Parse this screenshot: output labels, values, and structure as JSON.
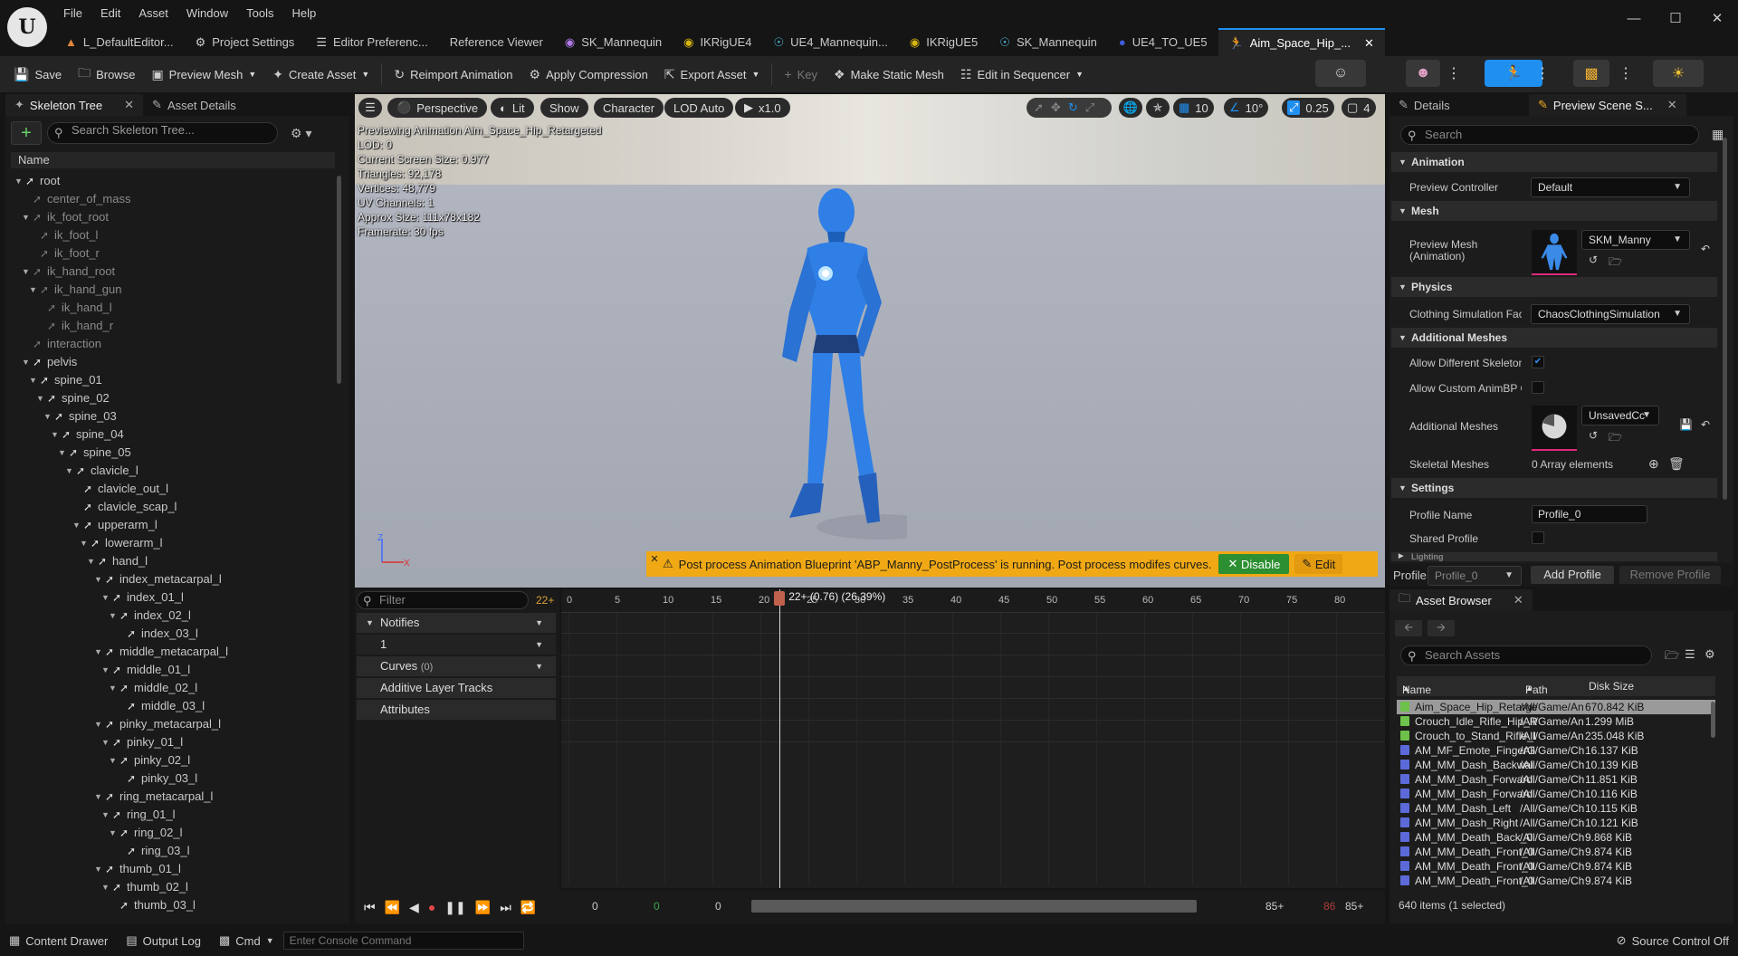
{
  "menu": [
    "File",
    "Edit",
    "Asset",
    "Window",
    "Tools",
    "Help"
  ],
  "doc_tabs": [
    {
      "label": "L_DefaultEditor...",
      "icon": "level-icon",
      "color": "#e2863b"
    },
    {
      "label": "Project Settings",
      "icon": "gear-icon",
      "color": "#cccccc"
    },
    {
      "label": "Editor Preferenc...",
      "icon": "sliders-icon",
      "color": "#cccccc"
    },
    {
      "label": "Reference Viewer",
      "icon": "",
      "color": "#cccccc"
    },
    {
      "label": "SK_Mannequin",
      "icon": "skeleton-icon",
      "color": "#b07ae8"
    },
    {
      "label": "IKRigUE4",
      "icon": "ikrig-icon",
      "color": "#d6b410"
    },
    {
      "label": "UE4_Mannequin...",
      "icon": "skeletal-mesh-icon",
      "color": "#4ec0e8"
    },
    {
      "label": "IKRigUE5",
      "icon": "ikrig-icon",
      "color": "#d6b410"
    },
    {
      "label": "SK_Mannequin",
      "icon": "skeletal-mesh-icon",
      "color": "#4ec0e8"
    },
    {
      "label": "UE4_TO_UE5",
      "icon": "retargeter-icon",
      "color": "#3f5bd8"
    },
    {
      "label": "Aim_Space_Hip_...",
      "icon": "animation-icon",
      "color": "#6cc24a",
      "active": true
    }
  ],
  "toolbar": {
    "save": "Save",
    "browse": "Browse",
    "preview_mesh": "Preview Mesh",
    "create_asset": "Create Asset",
    "reimport": "Reimport Animation",
    "apply_compression": "Apply Compression",
    "export_asset": "Export Asset",
    "key": "Key",
    "make_static_mesh": "Make Static Mesh",
    "edit_in_sequencer": "Edit in Sequencer"
  },
  "left_panel": {
    "tabs": [
      "Skeleton Tree",
      "Asset Details"
    ],
    "search_placeholder": "Search Skeleton Tree...",
    "column": "Name",
    "bones": [
      {
        "name": "root",
        "depth": 0,
        "dim": false
      },
      {
        "name": "center_of_mass",
        "depth": 1,
        "dim": true
      },
      {
        "name": "ik_foot_root",
        "depth": 1,
        "dim": true
      },
      {
        "name": "ik_foot_l",
        "depth": 2,
        "dim": true
      },
      {
        "name": "ik_foot_r",
        "depth": 2,
        "dim": true
      },
      {
        "name": "ik_hand_root",
        "depth": 1,
        "dim": true
      },
      {
        "name": "ik_hand_gun",
        "depth": 2,
        "dim": true
      },
      {
        "name": "ik_hand_l",
        "depth": 3,
        "dim": true
      },
      {
        "name": "ik_hand_r",
        "depth": 3,
        "dim": true
      },
      {
        "name": "interaction",
        "depth": 1,
        "dim": true
      },
      {
        "name": "pelvis",
        "depth": 1,
        "dim": false
      },
      {
        "name": "spine_01",
        "depth": 2,
        "dim": false
      },
      {
        "name": "spine_02",
        "depth": 3,
        "dim": false
      },
      {
        "name": "spine_03",
        "depth": 4,
        "dim": false
      },
      {
        "name": "spine_04",
        "depth": 5,
        "dim": false
      },
      {
        "name": "spine_05",
        "depth": 6,
        "dim": false
      },
      {
        "name": "clavicle_l",
        "depth": 7,
        "dim": false
      },
      {
        "name": "clavicle_out_l",
        "depth": 8,
        "dim": false
      },
      {
        "name": "clavicle_scap_l",
        "depth": 8,
        "dim": false
      },
      {
        "name": "upperarm_l",
        "depth": 8,
        "dim": false
      },
      {
        "name": "lowerarm_l",
        "depth": 9,
        "dim": false
      },
      {
        "name": "hand_l",
        "depth": 10,
        "dim": false
      },
      {
        "name": "index_metacarpal_l",
        "depth": 11,
        "dim": false
      },
      {
        "name": "index_01_l",
        "depth": 12,
        "dim": false
      },
      {
        "name": "index_02_l",
        "depth": 13,
        "dim": false
      },
      {
        "name": "index_03_l",
        "depth": 14,
        "dim": false
      },
      {
        "name": "middle_metacarpal_l",
        "depth": 11,
        "dim": false
      },
      {
        "name": "middle_01_l",
        "depth": 12,
        "dim": false
      },
      {
        "name": "middle_02_l",
        "depth": 13,
        "dim": false
      },
      {
        "name": "middle_03_l",
        "depth": 14,
        "dim": false
      },
      {
        "name": "pinky_metacarpal_l",
        "depth": 11,
        "dim": false
      },
      {
        "name": "pinky_01_l",
        "depth": 12,
        "dim": false
      },
      {
        "name": "pinky_02_l",
        "depth": 13,
        "dim": false
      },
      {
        "name": "pinky_03_l",
        "depth": 14,
        "dim": false
      },
      {
        "name": "ring_metacarpal_l",
        "depth": 11,
        "dim": false
      },
      {
        "name": "ring_01_l",
        "depth": 12,
        "dim": false
      },
      {
        "name": "ring_02_l",
        "depth": 13,
        "dim": false
      },
      {
        "name": "ring_03_l",
        "depth": 14,
        "dim": false
      },
      {
        "name": "thumb_01_l",
        "depth": 11,
        "dim": false
      },
      {
        "name": "thumb_02_l",
        "depth": 12,
        "dim": false
      },
      {
        "name": "thumb_03_l",
        "depth": 13,
        "dim": false
      }
    ]
  },
  "viewport": {
    "buttons": {
      "perspective": "Perspective",
      "lit": "Lit",
      "show": "Show",
      "character": "Character",
      "lod": "LOD Auto",
      "speed": "x1.0"
    },
    "right_controls": {
      "grid": "10",
      "rot": "10°",
      "scale": "0.25",
      "cam": "4"
    },
    "stats": [
      "Previewing Animation Aim_Space_Hip_Retargeted",
      "LOD: 0",
      "Current Screen Size: 0.977",
      "Triangles: 92,178",
      "Vertices: 48,779",
      "UV Channels: 1",
      "Approx Size: 111x78x182",
      "Framerate: 30 fps"
    ],
    "warning": "Post process Animation Blueprint 'ABP_Manny_PostProcess' is running. Post process modifes curves.",
    "warning_disable": "Disable",
    "warning_edit": "Edit",
    "axis_z": "Z",
    "axis_x": "X"
  },
  "timeline": {
    "filter_placeholder": "Filter",
    "frame_marker": "22+",
    "tracks": {
      "notifies": "Notifies",
      "notify_1": "1",
      "curves": "Curves",
      "curves_count": "(0)",
      "additive": "Additive Layer Tracks",
      "attributes": "Attributes"
    },
    "ruler": [
      "0",
      "5",
      "10",
      "15",
      "20",
      "25",
      "30",
      "35",
      "40",
      "45",
      "50",
      "55",
      "60",
      "65",
      "70",
      "75",
      "80"
    ],
    "playhead_label": "22+ (0.76) (26.39%)",
    "bottom": {
      "a": "0",
      "b": "0",
      "c": "0",
      "d": "85+",
      "e": "86",
      "f": "85+"
    }
  },
  "details": {
    "tabs": [
      "Details",
      "Preview Scene S..."
    ],
    "search_placeholder": "Search",
    "categories": {
      "animation": "Animation",
      "mesh": "Mesh",
      "physics": "Physics",
      "additional": "Additional Meshes",
      "settings": "Settings",
      "lighting": "Lighting"
    },
    "props": {
      "preview_controller": "Preview Controller",
      "preview_controller_val": "Default",
      "preview_mesh": "Preview Mesh (Animation)",
      "preview_mesh_val": "SKM_Manny",
      "clothing": "Clothing Simulation Fact",
      "clothing_val": "ChaosClothingSimulation",
      "allow_diff_skel": "Allow Different Skeleton",
      "allow_custom": "Allow Custom AnimBP C",
      "additional_meshes": "Additional Meshes",
      "additional_val": "UnsavedCc",
      "skeletal_meshes": "Skeletal Meshes",
      "skeletal_val": "0 Array elements",
      "profile_name": "Profile Name",
      "profile_name_val": "Profile_0",
      "shared_profile": "Shared Profile"
    },
    "profile_label": "Profile",
    "profile_val": "Profile_0",
    "add_profile": "Add Profile",
    "remove_profile": "Remove Profile"
  },
  "asset_browser": {
    "title": "Asset Browser",
    "search_placeholder": "Search Assets",
    "columns": {
      "name": "Name",
      "path": "Path",
      "size": "Disk Size"
    },
    "rows": [
      {
        "name": "Aim_Space_Hip_Retarge",
        "path": "/All/Game/An",
        "size": "670.842 KiB",
        "color": "#6cc24a",
        "selected": true
      },
      {
        "name": "Crouch_Idle_Rifle_Hip_R",
        "path": "/All/Game/An",
        "size": "1.299 MiB",
        "color": "#6cc24a"
      },
      {
        "name": "Crouch_to_Stand_Rifle_I",
        "path": "/All/Game/An",
        "size": "235.048 KiB",
        "color": "#6cc24a"
      },
      {
        "name": "AM_MF_Emote_FingerG",
        "path": "/All/Game/Ch",
        "size": "16.137 KiB",
        "color": "#5b6ad8"
      },
      {
        "name": "AM_MM_Dash_Backwai",
        "path": "/All/Game/Ch",
        "size": "10.139 KiB",
        "color": "#5b6ad8"
      },
      {
        "name": "AM_MM_Dash_Forward",
        "path": "/All/Game/Ch",
        "size": "11.851 KiB",
        "color": "#5b6ad8"
      },
      {
        "name": "AM_MM_Dash_Forward",
        "path": "/All/Game/Ch",
        "size": "10.116 KiB",
        "color": "#5b6ad8"
      },
      {
        "name": "AM_MM_Dash_Left",
        "path": "/All/Game/Ch",
        "size": "10.115 KiB",
        "color": "#5b6ad8"
      },
      {
        "name": "AM_MM_Dash_Right",
        "path": "/All/Game/Ch",
        "size": "10.121 KiB",
        "color": "#5b6ad8"
      },
      {
        "name": "AM_MM_Death_Back_0",
        "path": "/All/Game/Ch",
        "size": "9.868 KiB",
        "color": "#5b6ad8"
      },
      {
        "name": "AM_MM_Death_Front_0",
        "path": "/All/Game/Ch",
        "size": "9.874 KiB",
        "color": "#5b6ad8"
      },
      {
        "name": "AM_MM_Death_Front_0",
        "path": "/All/Game/Ch",
        "size": "9.874 KiB",
        "color": "#5b6ad8"
      },
      {
        "name": "AM_MM_Death_Front_0",
        "path": "/All/Game/Ch",
        "size": "9.874 KiB",
        "color": "#5b6ad8"
      }
    ],
    "count": "640 items (1 selected)"
  },
  "statusbar": {
    "content_drawer": "Content Drawer",
    "output_log": "Output Log",
    "cmd": "Cmd",
    "console_placeholder": "Enter Console Command",
    "source_control": "Source Control Off"
  },
  "colors": {
    "accent": "#1f8ff0",
    "warning": "#f0a915",
    "mannequin": "#2f7fe6"
  }
}
